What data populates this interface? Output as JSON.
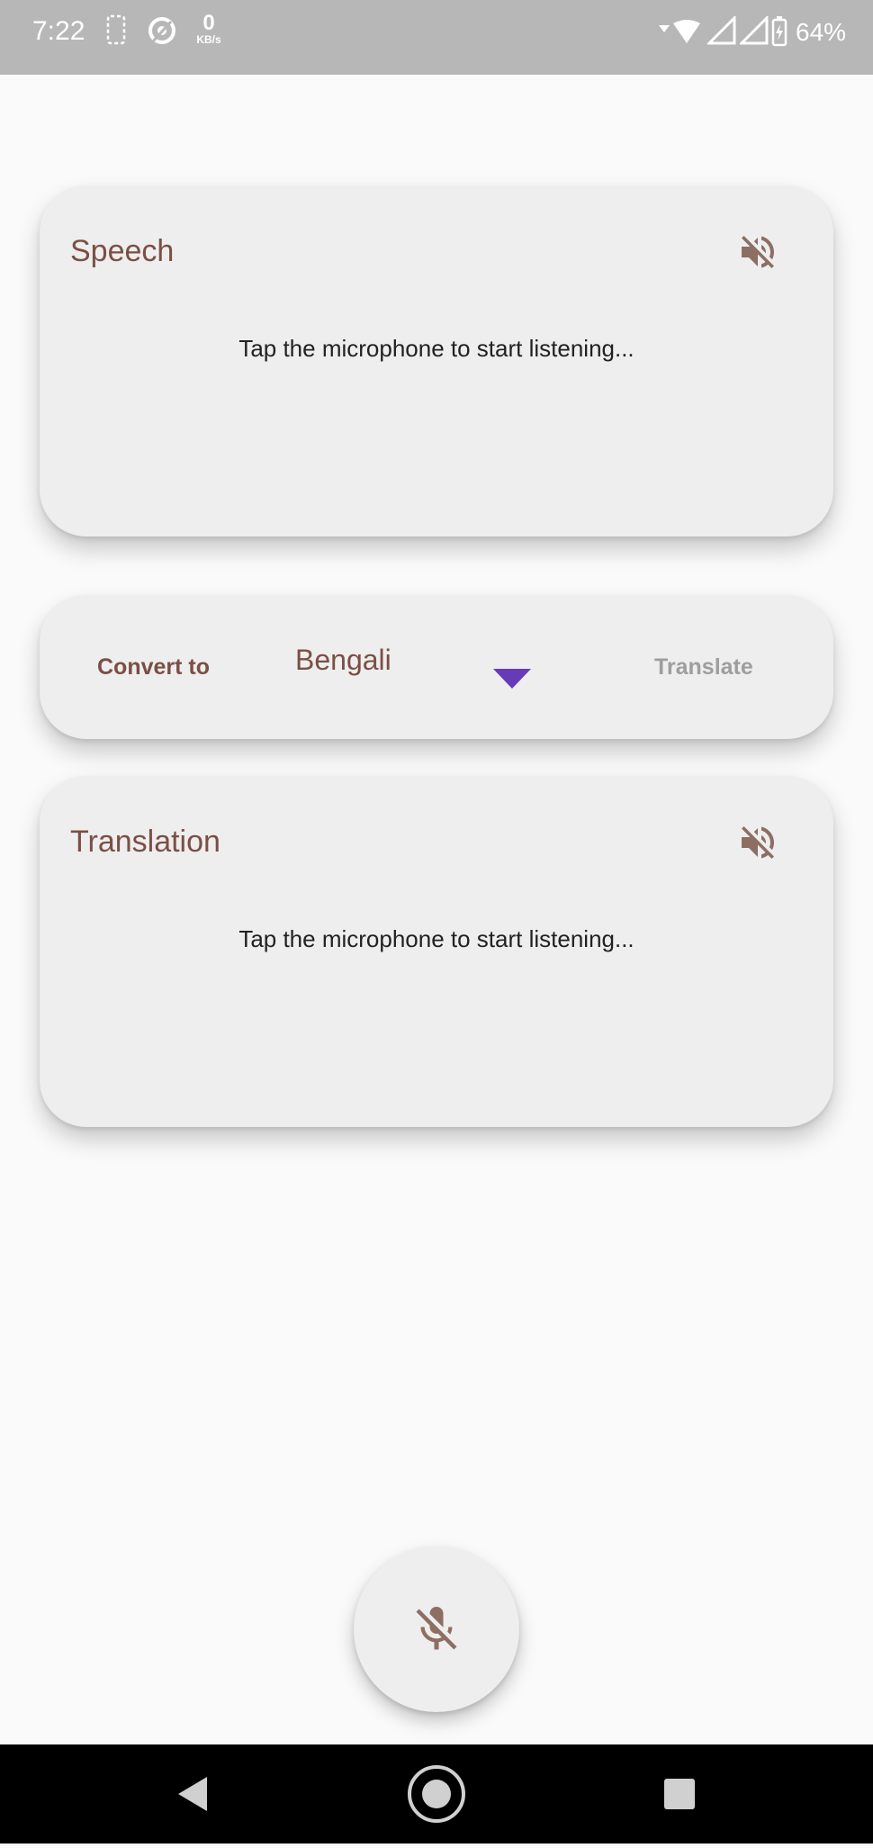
{
  "status_bar": {
    "time": "7:22",
    "net_speed_value": "0",
    "net_speed_unit": "KB/s",
    "battery_percent": "64%",
    "icons": [
      "sim-card-icon",
      "sync-icon",
      "wifi-icon",
      "signal-icon",
      "signal-icon",
      "battery-charging-icon"
    ]
  },
  "speech_card": {
    "title": "Speech",
    "body": "Tap the microphone to start listening...",
    "mute_icon": "volume-off-icon"
  },
  "convert_bar": {
    "label": "Convert to",
    "selected_language": "Bengali",
    "translate_label": "Translate"
  },
  "translation_card": {
    "title": "Translation",
    "body": "Tap the microphone to start listening...",
    "mute_icon": "volume-off-icon"
  },
  "fab": {
    "icon": "mic-off-icon"
  },
  "nav_bar": {
    "icons": [
      "back-icon",
      "home-icon",
      "recent-apps-icon"
    ]
  },
  "colors": {
    "accent_text": "#7b4f45",
    "dropdown_arrow": "#673ab7",
    "card_bg": "#eeeeee",
    "status_bar_bg": "#b7b7b7"
  }
}
